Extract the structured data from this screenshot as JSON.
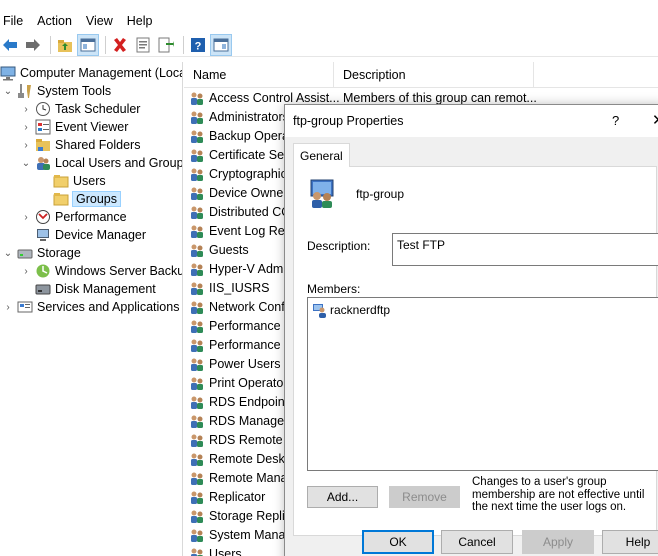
{
  "menu": {
    "file": "File",
    "action": "Action",
    "view": "View",
    "help": "Help"
  },
  "toolbar": {
    "buttons": [
      "back-arrow-icon",
      "forward-arrow-icon",
      "up-folder-icon",
      "show-hide-tree-icon",
      "delete-icon",
      "properties-icon",
      "export-list-icon",
      "help-icon",
      "action-pane-icon"
    ]
  },
  "tree": {
    "root": "Computer Management (Local",
    "system_tools": "System Tools",
    "task_scheduler": "Task Scheduler",
    "event_viewer": "Event Viewer",
    "shared_folders": "Shared Folders",
    "local_users_groups": "Local Users and Groups",
    "users": "Users",
    "groups": "Groups",
    "performance": "Performance",
    "device_manager": "Device Manager",
    "storage": "Storage",
    "windows_server_backup": "Windows Server Backup",
    "disk_management": "Disk Management",
    "services_apps": "Services and Applications"
  },
  "list": {
    "headers": {
      "name": "Name",
      "description": "Description"
    },
    "rows": [
      {
        "name": "Access Control Assist...",
        "description": "Members of this group can remot..."
      },
      {
        "name": "Administrators"
      },
      {
        "name": "Backup Operat"
      },
      {
        "name": "Certificate Serv"
      },
      {
        "name": "Cryptographic"
      },
      {
        "name": "Device Owners"
      },
      {
        "name": "Distributed CO"
      },
      {
        "name": "Event Log Rea"
      },
      {
        "name": "Guests"
      },
      {
        "name": "Hyper-V Admi"
      },
      {
        "name": "IIS_IUSRS"
      },
      {
        "name": "Network Confi"
      },
      {
        "name": "Performance L"
      },
      {
        "name": "Performance M"
      },
      {
        "name": "Power Users"
      },
      {
        "name": "Print Operator"
      },
      {
        "name": "RDS Endpoint"
      },
      {
        "name": "RDS Managem"
      },
      {
        "name": "RDS Remote A"
      },
      {
        "name": "Remote Deskto"
      },
      {
        "name": "Remote Manag"
      },
      {
        "name": "Replicator"
      },
      {
        "name": "Storage Replic"
      },
      {
        "name": "System Manag"
      },
      {
        "name": "Users"
      }
    ]
  },
  "dialog": {
    "title": "ftp-group Properties",
    "help_glyph": "?",
    "close_glyph": "✕",
    "tab_general": "General",
    "group_name": "ftp-group",
    "description_label": "Description:",
    "description_value": "Test FTP",
    "members_label": "Members:",
    "members": [
      "racknerdftp"
    ],
    "add_label": "Add...",
    "remove_label": "Remove",
    "note": "Changes to a user's group membership are not effective until the next time the user logs on.",
    "ok_label": "OK",
    "cancel_label": "Cancel",
    "apply_label": "Apply",
    "help_label": "Help"
  },
  "colors": {
    "selection": "#cce8ff",
    "accent": "#0078d7",
    "dialog_bg": "#f0f0f0"
  }
}
